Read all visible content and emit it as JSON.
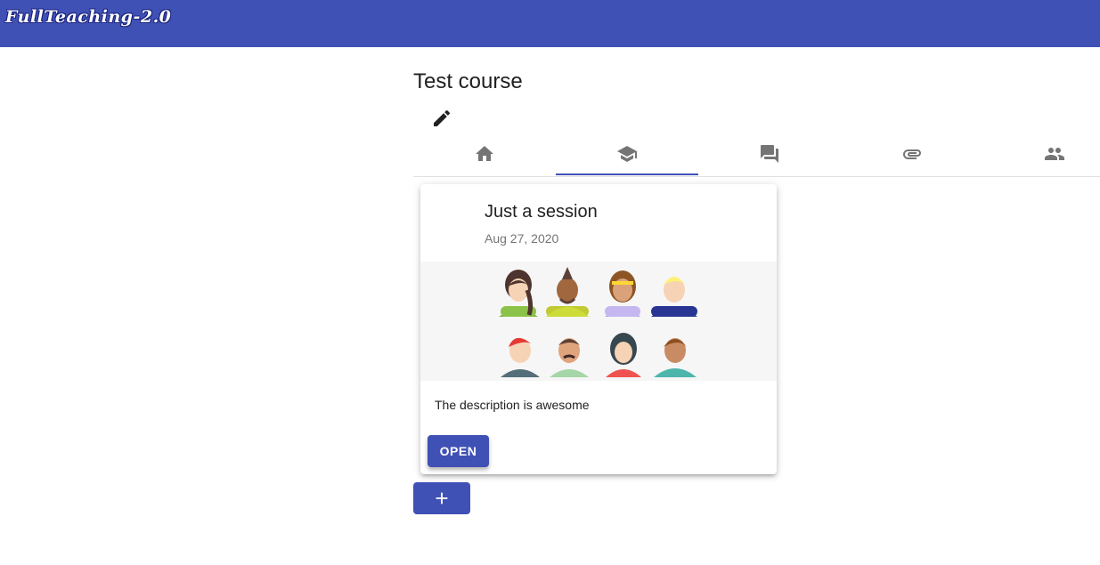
{
  "app": {
    "brand": "FullTeaching-2.0",
    "brand_color": "#3f51b5"
  },
  "course": {
    "title": "Test course"
  },
  "tabs": [
    {
      "icon": "home-icon",
      "active": false
    },
    {
      "icon": "school-icon",
      "active": true
    },
    {
      "icon": "forum-icon",
      "active": false
    },
    {
      "icon": "attachment-icon",
      "active": false
    },
    {
      "icon": "people-icon",
      "active": false
    }
  ],
  "session": {
    "title": "Just a session",
    "date": "Aug 27, 2020",
    "image": "group-of-avatars-illustration",
    "description": "The description is awesome",
    "open_label": "OPEN"
  },
  "add_button": {
    "icon": "add-icon"
  }
}
